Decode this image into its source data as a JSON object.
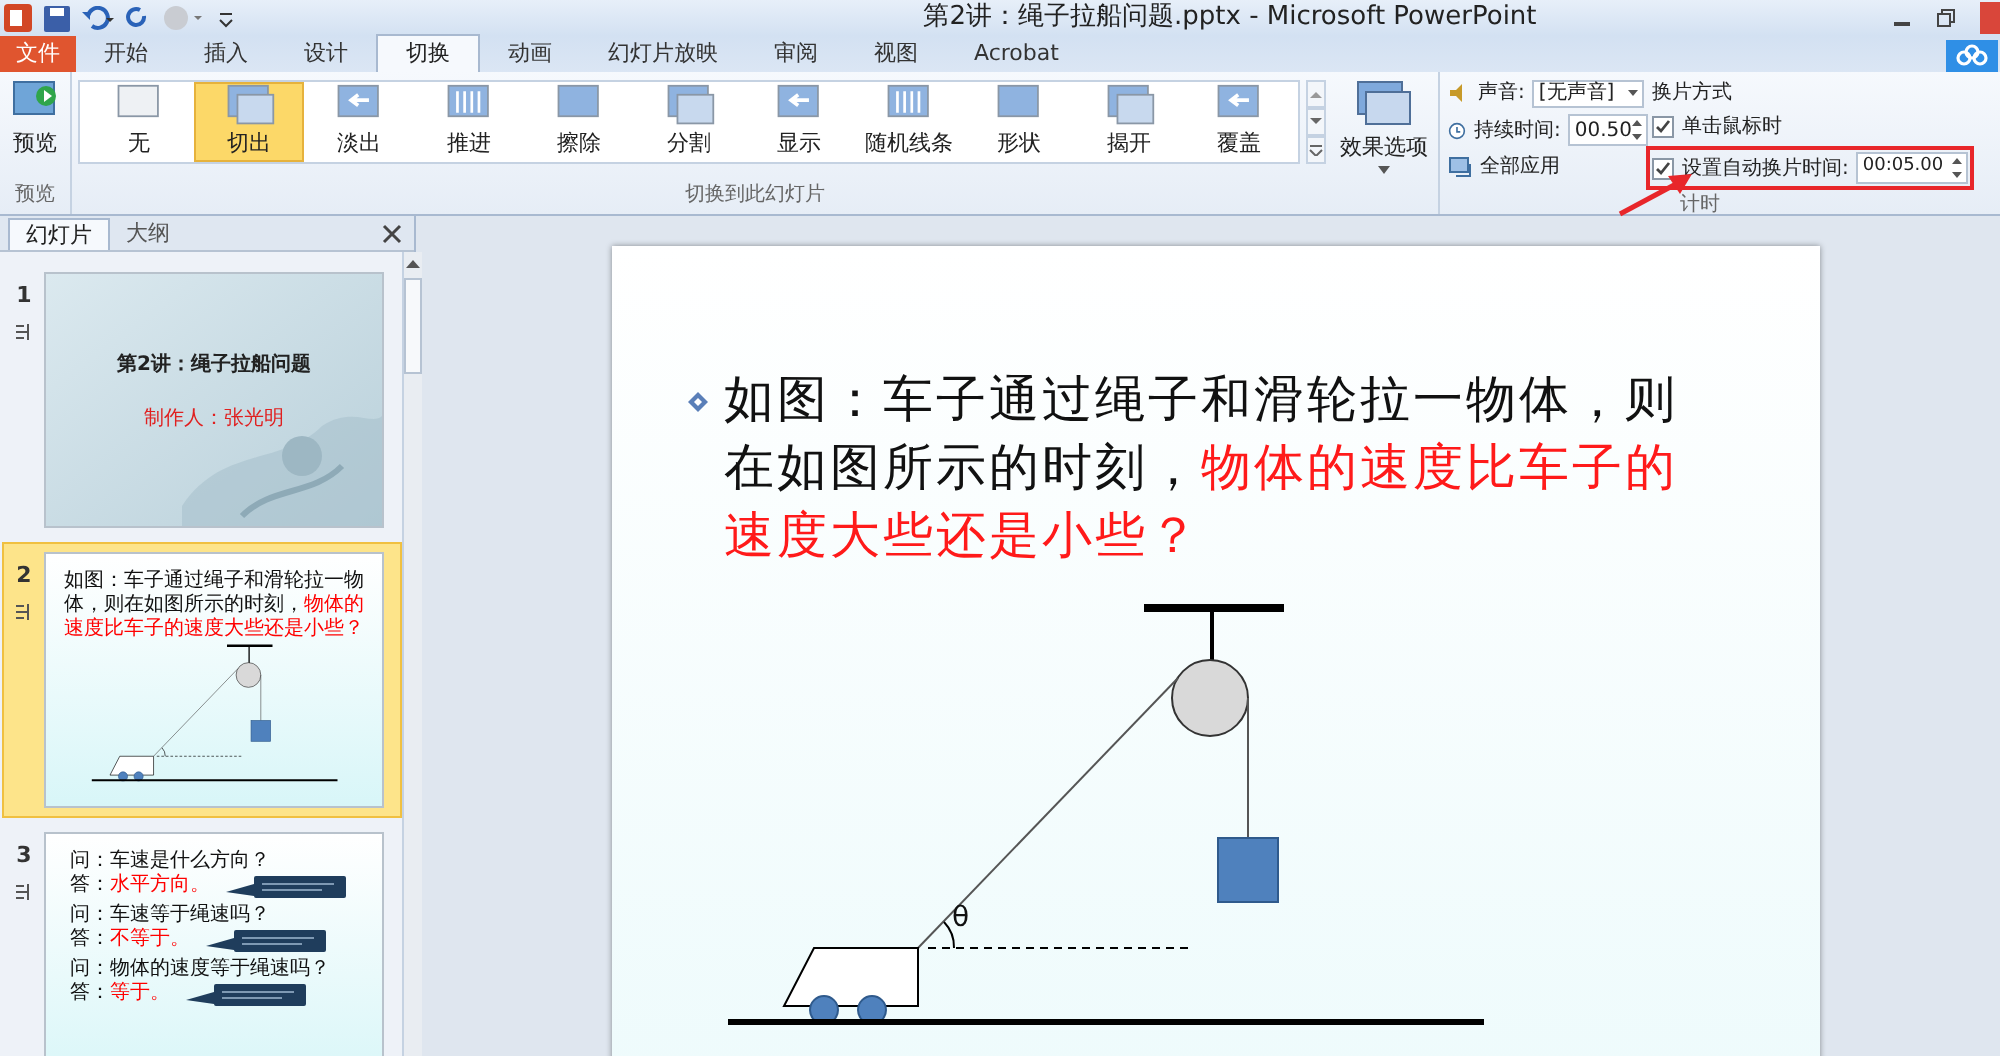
{
  "window": {
    "title": "第2讲：绳子拉船问题.pptx - Microsoft PowerPoint"
  },
  "ribbon_tabs": [
    {
      "label": "文件",
      "kind": "file",
      "selected": false
    },
    {
      "label": "开始",
      "kind": "tab",
      "selected": false
    },
    {
      "label": "插入",
      "kind": "tab",
      "selected": false
    },
    {
      "label": "设计",
      "kind": "tab",
      "selected": false
    },
    {
      "label": "切换",
      "kind": "tab",
      "selected": true
    },
    {
      "label": "动画",
      "kind": "tab",
      "selected": false
    },
    {
      "label": "幻灯片放映",
      "kind": "tab",
      "selected": false
    },
    {
      "label": "审阅",
      "kind": "tab",
      "selected": false
    },
    {
      "label": "视图",
      "kind": "tab",
      "selected": false
    },
    {
      "label": "Acrobat",
      "kind": "tab",
      "selected": false
    }
  ],
  "ribbon": {
    "preview": {
      "button": "预览",
      "group": "预览"
    },
    "transitions": {
      "items": [
        {
          "label": "无",
          "selected": false
        },
        {
          "label": "切出",
          "selected": true
        },
        {
          "label": "淡出",
          "selected": false
        },
        {
          "label": "推进",
          "selected": false
        },
        {
          "label": "擦除",
          "selected": false
        },
        {
          "label": "分割",
          "selected": false
        },
        {
          "label": "显示",
          "selected": false
        },
        {
          "label": "随机线条",
          "selected": false
        },
        {
          "label": "形状",
          "selected": false
        },
        {
          "label": "揭开",
          "selected": false
        },
        {
          "label": "覆盖",
          "selected": false
        }
      ],
      "effect_options": "效果选项",
      "group": "切换到此幻灯片"
    },
    "timing": {
      "sound_label": "声音:",
      "sound_value": "[无声音]",
      "duration_label": "持续时间:",
      "duration_value": "00.50",
      "apply_all": "全部应用",
      "advance_title": "换片方式",
      "on_click": {
        "label": "单击鼠标时",
        "checked": true
      },
      "after": {
        "label": "设置自动换片时间:",
        "checked": true,
        "value": "00:05.00"
      },
      "group": "计时"
    }
  },
  "slide_pane": {
    "tabs": [
      {
        "label": "幻灯片",
        "selected": true
      },
      {
        "label": "大纲",
        "selected": false
      }
    ],
    "slides": [
      {
        "number": "1",
        "kind": "title",
        "selected": false,
        "title": "第2讲：绳子拉船问题",
        "subtitle": "制作人：张光明"
      },
      {
        "number": "2",
        "kind": "question",
        "selected": true,
        "text": "如图：车子通过绳子和滑轮拉一物体，则在如图所示的时刻，",
        "highlight": "物体的速度比车子的速度大些还是小些？"
      },
      {
        "number": "3",
        "kind": "qa",
        "selected": false,
        "items": [
          {
            "question": "问：车速是什么方向？",
            "answer_label": "答：",
            "answer": "水平方向。"
          },
          {
            "question": "问：车速等于绳速吗？",
            "answer_label": "答：",
            "answer": "不等于。"
          },
          {
            "question": "问：物体的速度等于绳速吗？",
            "answer_label": "答：",
            "answer": "等于。"
          }
        ]
      }
    ]
  },
  "current_slide": {
    "text": "如图：车子通过绳子和滑轮拉一物体，则在如图所示的时刻，",
    "highlight": "物体的速度比车子的速度大些还是小些？",
    "angle_label": "θ"
  }
}
